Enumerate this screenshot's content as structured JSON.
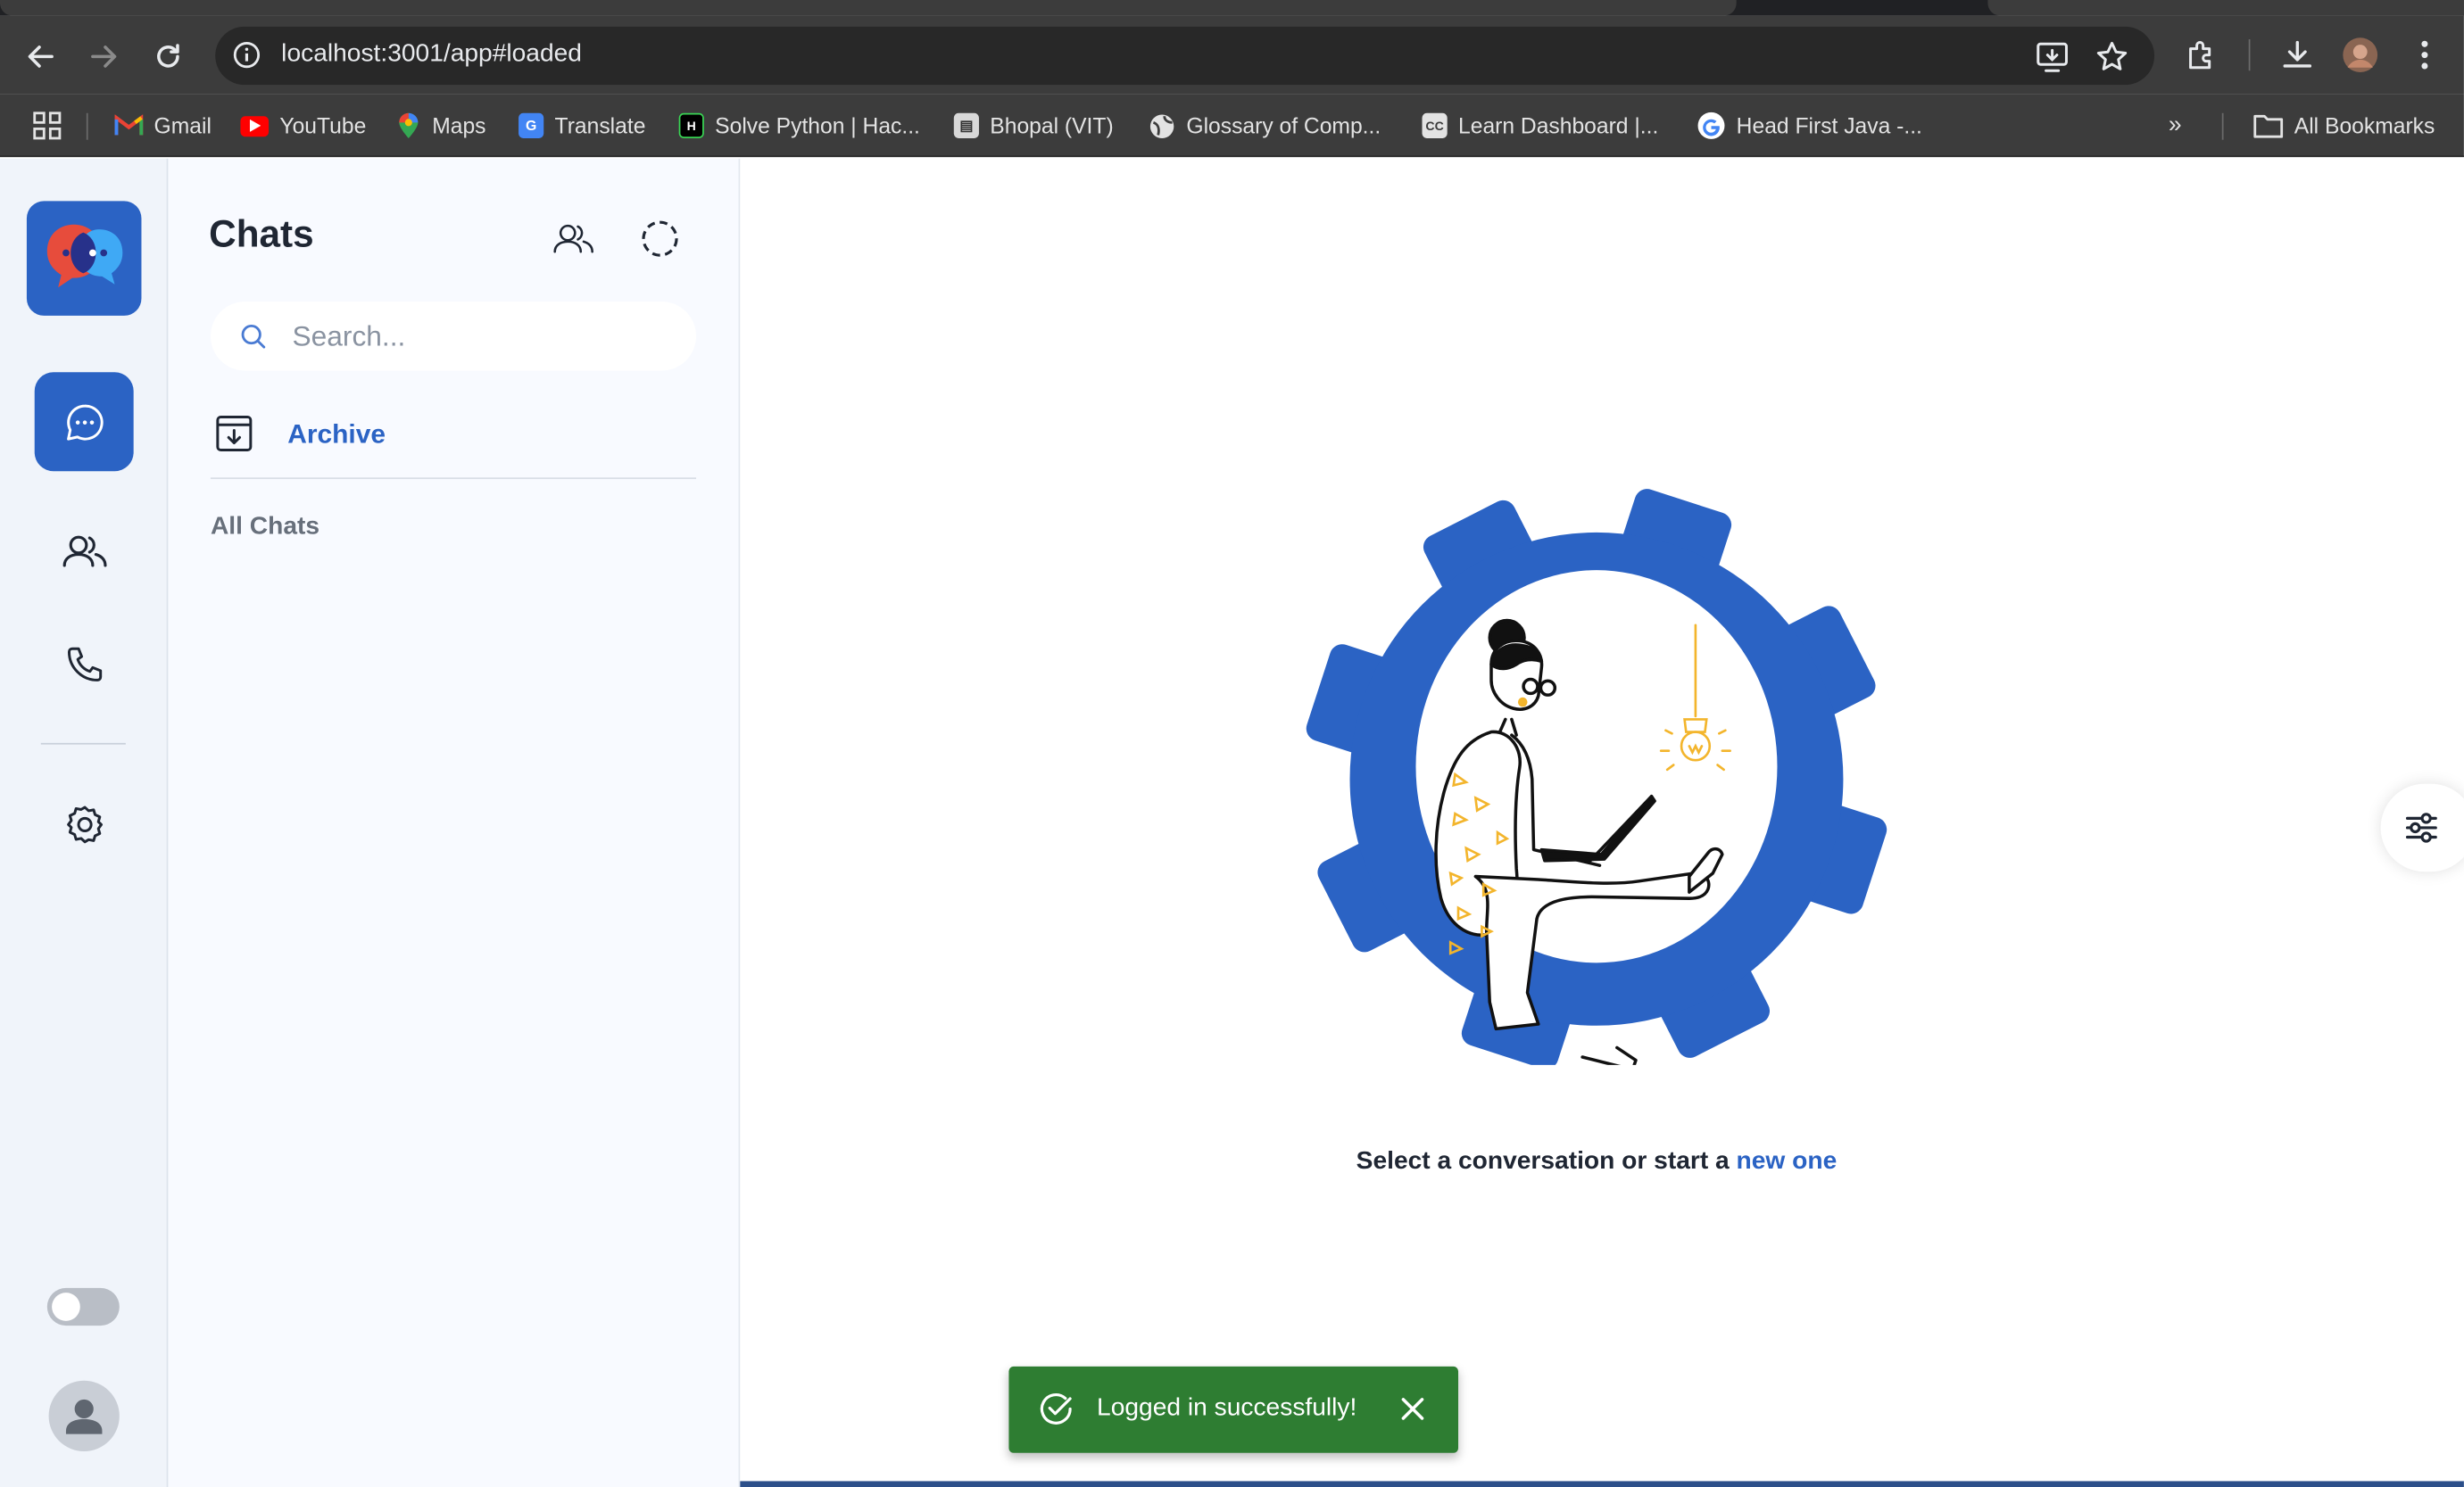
{
  "browser": {
    "url": "localhost:3001/app#loaded",
    "bookmarks": [
      {
        "label": "Gmail",
        "icon": "gmail-icon"
      },
      {
        "label": "YouTube",
        "icon": "youtube-icon"
      },
      {
        "label": "Maps",
        "icon": "maps-icon"
      },
      {
        "label": "Translate",
        "icon": "translate-icon"
      },
      {
        "label": "Solve Python | Hac...",
        "icon": "hackerrank-icon"
      },
      {
        "label": "Bhopal (VIT)",
        "icon": "vit-icon"
      },
      {
        "label": "Glossary of Comp...",
        "icon": "globe-icon"
      },
      {
        "label": "Learn Dashboard |...",
        "icon": "cc-icon"
      },
      {
        "label": "Head First Java -...",
        "icon": "google-icon"
      }
    ],
    "all_bookmarks": "All Bookmarks"
  },
  "sidebar": {
    "items": [
      {
        "name": "chats",
        "icon": "chat-bubble-icon",
        "active": true
      },
      {
        "name": "groups",
        "icon": "users-icon",
        "active": false
      },
      {
        "name": "calls",
        "icon": "phone-icon",
        "active": false
      },
      {
        "name": "settings",
        "icon": "gear-icon",
        "active": false
      }
    ],
    "theme_toggle_on": false
  },
  "panel": {
    "title": "Chats",
    "search_placeholder": "Search...",
    "archive_label": "Archive",
    "section_label": "All Chats"
  },
  "main": {
    "prompt_text": "Select a conversation or start a ",
    "prompt_link": "new one"
  },
  "toast": {
    "message": "Logged in successfully!",
    "status": "success"
  },
  "colors": {
    "brand": "#2b63c4",
    "toast_bg": "#2e7d32",
    "illustration_accent": "#f3b52c"
  }
}
